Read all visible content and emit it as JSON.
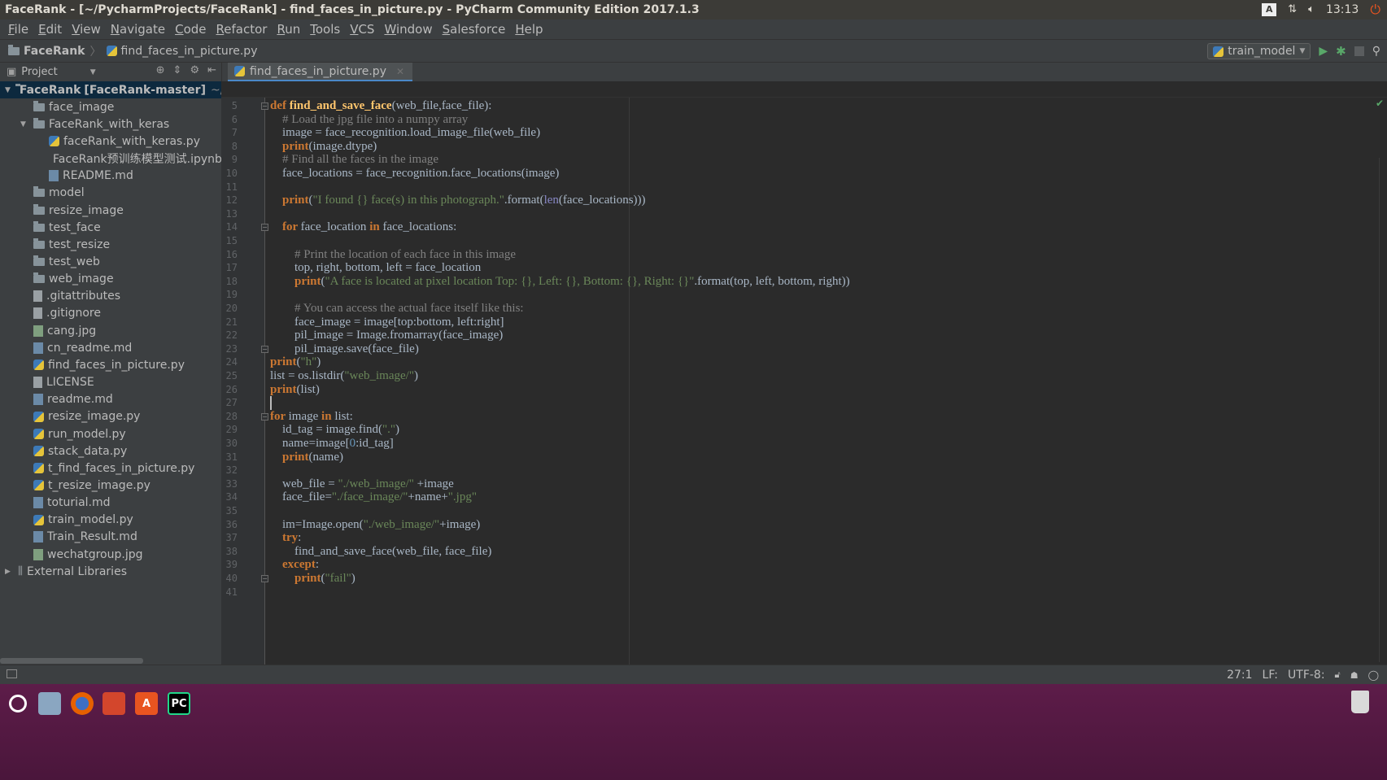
{
  "titlebar": {
    "title": "FaceRank - [~/PycharmProjects/FaceRank] - find_faces_in_picture.py - PyCharm Community Edition 2017.1.3",
    "keyboard_label": "A",
    "clock": "13:13"
  },
  "menu": [
    {
      "label": "File",
      "mn": "F",
      "rest": "ile"
    },
    {
      "label": "Edit",
      "mn": "E",
      "rest": "dit"
    },
    {
      "label": "View",
      "mn": "V",
      "rest": "iew"
    },
    {
      "label": "Navigate",
      "mn": "N",
      "rest": "avigate"
    },
    {
      "label": "Code",
      "mn": "C",
      "rest": "ode"
    },
    {
      "label": "Refactor",
      "mn": "R",
      "rest": "efactor"
    },
    {
      "label": "Run",
      "mn": "R",
      "rest": "un",
      "mnIndex": 1
    },
    {
      "label": "Tools",
      "mn": "T",
      "rest": "ools"
    },
    {
      "label": "VCS",
      "mn": "V",
      "rest": "CS"
    },
    {
      "label": "Window",
      "mn": "W",
      "rest": "indow"
    },
    {
      "label": "Salesforce",
      "mn": "S",
      "rest": "alesforce"
    },
    {
      "label": "Help",
      "mn": "H",
      "rest": "elp"
    }
  ],
  "navbar": {
    "project": "FaceRank",
    "file": "find_faces_in_picture.py",
    "run_config": "train_model"
  },
  "project_pane": {
    "header": "Project",
    "tree": [
      {
        "depth": 0,
        "arrow": "▼",
        "icon": "folder",
        "label": "FaceRank",
        "branch": "[FaceRank-master]",
        "path": "~/Pych",
        "selected": true
      },
      {
        "depth": 1,
        "icon": "folder",
        "label": "face_image"
      },
      {
        "depth": 1,
        "arrow": "▼",
        "icon": "folder",
        "label": "FaceRank_with_keras"
      },
      {
        "depth": 2,
        "icon": "py",
        "label": "faceRank_with_keras.py"
      },
      {
        "depth": 2,
        "icon": "md",
        "label": "FaceRank预训练模型测试.ipynb"
      },
      {
        "depth": 2,
        "icon": "md",
        "label": "README.md"
      },
      {
        "depth": 1,
        "icon": "folder",
        "label": "model"
      },
      {
        "depth": 1,
        "icon": "folder",
        "label": "resize_image"
      },
      {
        "depth": 1,
        "icon": "folder",
        "label": "test_face"
      },
      {
        "depth": 1,
        "icon": "folder",
        "label": "test_resize"
      },
      {
        "depth": 1,
        "icon": "folder",
        "label": "test_web"
      },
      {
        "depth": 1,
        "icon": "folder",
        "label": "web_image"
      },
      {
        "depth": 1,
        "icon": "file",
        "label": ".gitattributes"
      },
      {
        "depth": 1,
        "icon": "file",
        "label": ".gitignore"
      },
      {
        "depth": 1,
        "icon": "img",
        "label": "cang.jpg"
      },
      {
        "depth": 1,
        "icon": "md",
        "label": "cn_readme.md"
      },
      {
        "depth": 1,
        "icon": "py",
        "label": "find_faces_in_picture.py"
      },
      {
        "depth": 1,
        "icon": "file",
        "label": "LICENSE"
      },
      {
        "depth": 1,
        "icon": "md",
        "label": "readme.md"
      },
      {
        "depth": 1,
        "icon": "py",
        "label": "resize_image.py"
      },
      {
        "depth": 1,
        "icon": "py",
        "label": "run_model.py"
      },
      {
        "depth": 1,
        "icon": "py",
        "label": "stack_data.py"
      },
      {
        "depth": 1,
        "icon": "py",
        "label": "t_find_faces_in_picture.py"
      },
      {
        "depth": 1,
        "icon": "py",
        "label": "t_resize_image.py"
      },
      {
        "depth": 1,
        "icon": "md",
        "label": "toturial.md"
      },
      {
        "depth": 1,
        "icon": "py",
        "label": "train_model.py"
      },
      {
        "depth": 1,
        "icon": "md",
        "label": "Train_Result.md"
      },
      {
        "depth": 1,
        "icon": "img",
        "label": "wechatgroup.jpg"
      },
      {
        "depth": 0,
        "arrow": "▶",
        "icon": "lib",
        "label": "External Libraries"
      }
    ]
  },
  "editor": {
    "tab": "find_faces_in_picture.py",
    "lines": [
      {
        "n": 5,
        "fold": "-",
        "toks": [
          [
            "kw",
            "def "
          ],
          [
            "fn",
            "find_and_save_face"
          ],
          [
            "",
            "(web_file,face_file):"
          ]
        ]
      },
      {
        "n": 6,
        "toks": [
          [
            "",
            "    "
          ],
          [
            "cm",
            "# Load the jpg file into a numpy array"
          ]
        ]
      },
      {
        "n": 7,
        "toks": [
          [
            "",
            "    image = face_recognition.load_image_file(web_file)"
          ]
        ]
      },
      {
        "n": 8,
        "toks": [
          [
            "",
            "    "
          ],
          [
            "kw",
            "print"
          ],
          [
            "",
            "(image.dtype)"
          ]
        ]
      },
      {
        "n": 9,
        "toks": [
          [
            "",
            "    "
          ],
          [
            "cm",
            "# Find all the faces in the image"
          ]
        ]
      },
      {
        "n": 10,
        "toks": [
          [
            "",
            "    face_locations = face_recognition.face_locations(image)"
          ]
        ]
      },
      {
        "n": 11,
        "toks": []
      },
      {
        "n": 12,
        "toks": [
          [
            "",
            "    "
          ],
          [
            "kw",
            "print"
          ],
          [
            "",
            "("
          ],
          [
            "st",
            "\"I found {} face(s) in this photograph.\""
          ],
          [
            "",
            ".format("
          ],
          [
            "bi",
            "len"
          ],
          [
            "",
            "(face_locations)))"
          ]
        ]
      },
      {
        "n": 13,
        "toks": []
      },
      {
        "n": 14,
        "fold": "-",
        "toks": [
          [
            "",
            "    "
          ],
          [
            "kw",
            "for "
          ],
          [
            "",
            "face_location "
          ],
          [
            "kw",
            "in "
          ],
          [
            "",
            "face_locations:"
          ]
        ]
      },
      {
        "n": 15,
        "toks": []
      },
      {
        "n": 16,
        "toks": [
          [
            "",
            "        "
          ],
          [
            "cm",
            "# Print the location of each face in this image"
          ]
        ]
      },
      {
        "n": 17,
        "toks": [
          [
            "",
            "        top, right, bottom, left = face_location"
          ]
        ]
      },
      {
        "n": 18,
        "toks": [
          [
            "",
            "        "
          ],
          [
            "kw",
            "print"
          ],
          [
            "",
            "("
          ],
          [
            "st",
            "\"A face is located at pixel location Top: {}, Left: {}, Bottom: {}, Right: {}\""
          ],
          [
            "",
            ".format(top, left, bottom, right))"
          ]
        ]
      },
      {
        "n": 19,
        "toks": []
      },
      {
        "n": 20,
        "toks": [
          [
            "",
            "        "
          ],
          [
            "cm",
            "# You can access the actual face itself like this:"
          ]
        ]
      },
      {
        "n": 21,
        "toks": [
          [
            "",
            "        face_image = image[top:bottom, left:right]"
          ]
        ]
      },
      {
        "n": 22,
        "toks": [
          [
            "",
            "        pil_image = Image.fromarray(face_image)"
          ]
        ]
      },
      {
        "n": 23,
        "fold": "-",
        "toks": [
          [
            "",
            "        pil_image.save(face_file)"
          ]
        ]
      },
      {
        "n": 24,
        "toks": [
          [
            "kw",
            "print"
          ],
          [
            "",
            "("
          ],
          [
            "st",
            "\"h\""
          ],
          [
            "",
            ")"
          ]
        ]
      },
      {
        "n": 25,
        "toks": [
          [
            "",
            "list = os.listdir("
          ],
          [
            "st",
            "\"web_image/\""
          ],
          [
            "",
            ")"
          ]
        ]
      },
      {
        "n": 26,
        "toks": [
          [
            "kw",
            "print"
          ],
          [
            "",
            "(list)"
          ]
        ]
      },
      {
        "n": 27,
        "toks": []
      },
      {
        "n": 28,
        "fold": "-",
        "toks": [
          [
            "kw",
            "for "
          ],
          [
            "",
            "image "
          ],
          [
            "kw",
            "in "
          ],
          [
            "",
            "list:"
          ]
        ]
      },
      {
        "n": 29,
        "toks": [
          [
            "",
            "    id_tag = image.find("
          ],
          [
            "st",
            "\".\""
          ],
          [
            "",
            ")"
          ]
        ]
      },
      {
        "n": 30,
        "toks": [
          [
            "",
            "    name=image["
          ],
          [
            "nu",
            "0"
          ],
          [
            "",
            ":id_tag]"
          ]
        ]
      },
      {
        "n": 31,
        "toks": [
          [
            "",
            "    "
          ],
          [
            "kw",
            "print"
          ],
          [
            "",
            "(name)"
          ]
        ]
      },
      {
        "n": 32,
        "toks": []
      },
      {
        "n": 33,
        "toks": [
          [
            "",
            "    web_file = "
          ],
          [
            "st",
            "\"./web_image/\""
          ],
          [
            "",
            " +image"
          ]
        ]
      },
      {
        "n": 34,
        "toks": [
          [
            "",
            "    face_file="
          ],
          [
            "st",
            "\"./face_image/\""
          ],
          [
            "",
            "+name+"
          ],
          [
            "st",
            "\".jpg\""
          ]
        ]
      },
      {
        "n": 35,
        "toks": []
      },
      {
        "n": 36,
        "toks": [
          [
            "",
            "    im=Image.open("
          ],
          [
            "st",
            "\"./web_image/\""
          ],
          [
            "",
            "+image)"
          ]
        ]
      },
      {
        "n": 37,
        "toks": [
          [
            "",
            "    "
          ],
          [
            "kw",
            "try"
          ],
          [
            "",
            ":"
          ]
        ]
      },
      {
        "n": 38,
        "toks": [
          [
            "",
            "        find_and_save_face(web_file, face_file)"
          ]
        ]
      },
      {
        "n": 39,
        "toks": [
          [
            "",
            "    "
          ],
          [
            "kw",
            "except"
          ],
          [
            "",
            ":"
          ]
        ]
      },
      {
        "n": 40,
        "fold": "-",
        "toks": [
          [
            "",
            "        "
          ],
          [
            "kw",
            "print"
          ],
          [
            "",
            "("
          ],
          [
            "st",
            "\"fail\""
          ],
          [
            "",
            ")"
          ]
        ]
      },
      {
        "n": 41,
        "toks": []
      }
    ],
    "caret_line": 27
  },
  "statusbar": {
    "position": "27:1",
    "line_sep": "LF:",
    "encoding": "UTF-8:"
  },
  "taskbar": {
    "apps": [
      "ubuntu-dash-icon",
      "files-icon",
      "firefox-icon",
      "app-icon",
      "software-center-icon",
      "pycharm-icon"
    ],
    "pycharm_label": "PC"
  }
}
